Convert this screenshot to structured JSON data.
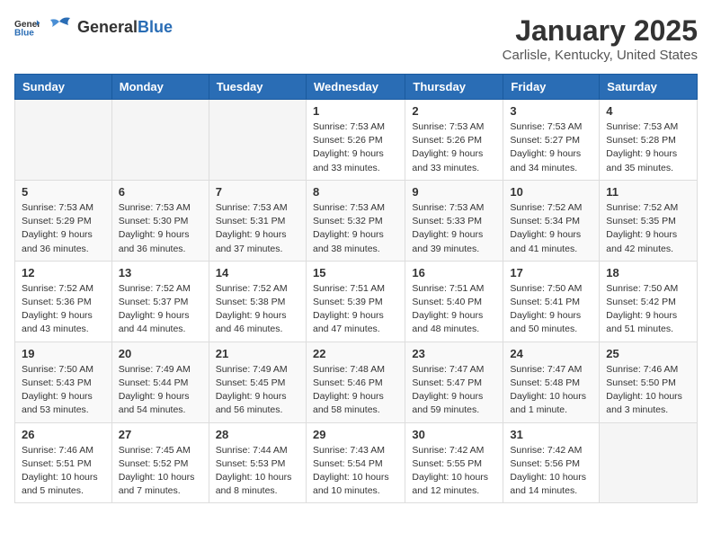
{
  "header": {
    "logo": {
      "general": "General",
      "blue": "Blue"
    },
    "title": "January 2025",
    "location": "Carlisle, Kentucky, United States"
  },
  "weekdays": [
    "Sunday",
    "Monday",
    "Tuesday",
    "Wednesday",
    "Thursday",
    "Friday",
    "Saturday"
  ],
  "weeks": [
    [
      {
        "day": "",
        "info": ""
      },
      {
        "day": "",
        "info": ""
      },
      {
        "day": "",
        "info": ""
      },
      {
        "day": "1",
        "info": "Sunrise: 7:53 AM\nSunset: 5:26 PM\nDaylight: 9 hours and 33 minutes."
      },
      {
        "day": "2",
        "info": "Sunrise: 7:53 AM\nSunset: 5:26 PM\nDaylight: 9 hours and 33 minutes."
      },
      {
        "day": "3",
        "info": "Sunrise: 7:53 AM\nSunset: 5:27 PM\nDaylight: 9 hours and 34 minutes."
      },
      {
        "day": "4",
        "info": "Sunrise: 7:53 AM\nSunset: 5:28 PM\nDaylight: 9 hours and 35 minutes."
      }
    ],
    [
      {
        "day": "5",
        "info": "Sunrise: 7:53 AM\nSunset: 5:29 PM\nDaylight: 9 hours and 36 minutes."
      },
      {
        "day": "6",
        "info": "Sunrise: 7:53 AM\nSunset: 5:30 PM\nDaylight: 9 hours and 36 minutes."
      },
      {
        "day": "7",
        "info": "Sunrise: 7:53 AM\nSunset: 5:31 PM\nDaylight: 9 hours and 37 minutes."
      },
      {
        "day": "8",
        "info": "Sunrise: 7:53 AM\nSunset: 5:32 PM\nDaylight: 9 hours and 38 minutes."
      },
      {
        "day": "9",
        "info": "Sunrise: 7:53 AM\nSunset: 5:33 PM\nDaylight: 9 hours and 39 minutes."
      },
      {
        "day": "10",
        "info": "Sunrise: 7:52 AM\nSunset: 5:34 PM\nDaylight: 9 hours and 41 minutes."
      },
      {
        "day": "11",
        "info": "Sunrise: 7:52 AM\nSunset: 5:35 PM\nDaylight: 9 hours and 42 minutes."
      }
    ],
    [
      {
        "day": "12",
        "info": "Sunrise: 7:52 AM\nSunset: 5:36 PM\nDaylight: 9 hours and 43 minutes."
      },
      {
        "day": "13",
        "info": "Sunrise: 7:52 AM\nSunset: 5:37 PM\nDaylight: 9 hours and 44 minutes."
      },
      {
        "day": "14",
        "info": "Sunrise: 7:52 AM\nSunset: 5:38 PM\nDaylight: 9 hours and 46 minutes."
      },
      {
        "day": "15",
        "info": "Sunrise: 7:51 AM\nSunset: 5:39 PM\nDaylight: 9 hours and 47 minutes."
      },
      {
        "day": "16",
        "info": "Sunrise: 7:51 AM\nSunset: 5:40 PM\nDaylight: 9 hours and 48 minutes."
      },
      {
        "day": "17",
        "info": "Sunrise: 7:50 AM\nSunset: 5:41 PM\nDaylight: 9 hours and 50 minutes."
      },
      {
        "day": "18",
        "info": "Sunrise: 7:50 AM\nSunset: 5:42 PM\nDaylight: 9 hours and 51 minutes."
      }
    ],
    [
      {
        "day": "19",
        "info": "Sunrise: 7:50 AM\nSunset: 5:43 PM\nDaylight: 9 hours and 53 minutes."
      },
      {
        "day": "20",
        "info": "Sunrise: 7:49 AM\nSunset: 5:44 PM\nDaylight: 9 hours and 54 minutes."
      },
      {
        "day": "21",
        "info": "Sunrise: 7:49 AM\nSunset: 5:45 PM\nDaylight: 9 hours and 56 minutes."
      },
      {
        "day": "22",
        "info": "Sunrise: 7:48 AM\nSunset: 5:46 PM\nDaylight: 9 hours and 58 minutes."
      },
      {
        "day": "23",
        "info": "Sunrise: 7:47 AM\nSunset: 5:47 PM\nDaylight: 9 hours and 59 minutes."
      },
      {
        "day": "24",
        "info": "Sunrise: 7:47 AM\nSunset: 5:48 PM\nDaylight: 10 hours and 1 minute."
      },
      {
        "day": "25",
        "info": "Sunrise: 7:46 AM\nSunset: 5:50 PM\nDaylight: 10 hours and 3 minutes."
      }
    ],
    [
      {
        "day": "26",
        "info": "Sunrise: 7:46 AM\nSunset: 5:51 PM\nDaylight: 10 hours and 5 minutes."
      },
      {
        "day": "27",
        "info": "Sunrise: 7:45 AM\nSunset: 5:52 PM\nDaylight: 10 hours and 7 minutes."
      },
      {
        "day": "28",
        "info": "Sunrise: 7:44 AM\nSunset: 5:53 PM\nDaylight: 10 hours and 8 minutes."
      },
      {
        "day": "29",
        "info": "Sunrise: 7:43 AM\nSunset: 5:54 PM\nDaylight: 10 hours and 10 minutes."
      },
      {
        "day": "30",
        "info": "Sunrise: 7:42 AM\nSunset: 5:55 PM\nDaylight: 10 hours and 12 minutes."
      },
      {
        "day": "31",
        "info": "Sunrise: 7:42 AM\nSunset: 5:56 PM\nDaylight: 10 hours and 14 minutes."
      },
      {
        "day": "",
        "info": ""
      }
    ]
  ]
}
